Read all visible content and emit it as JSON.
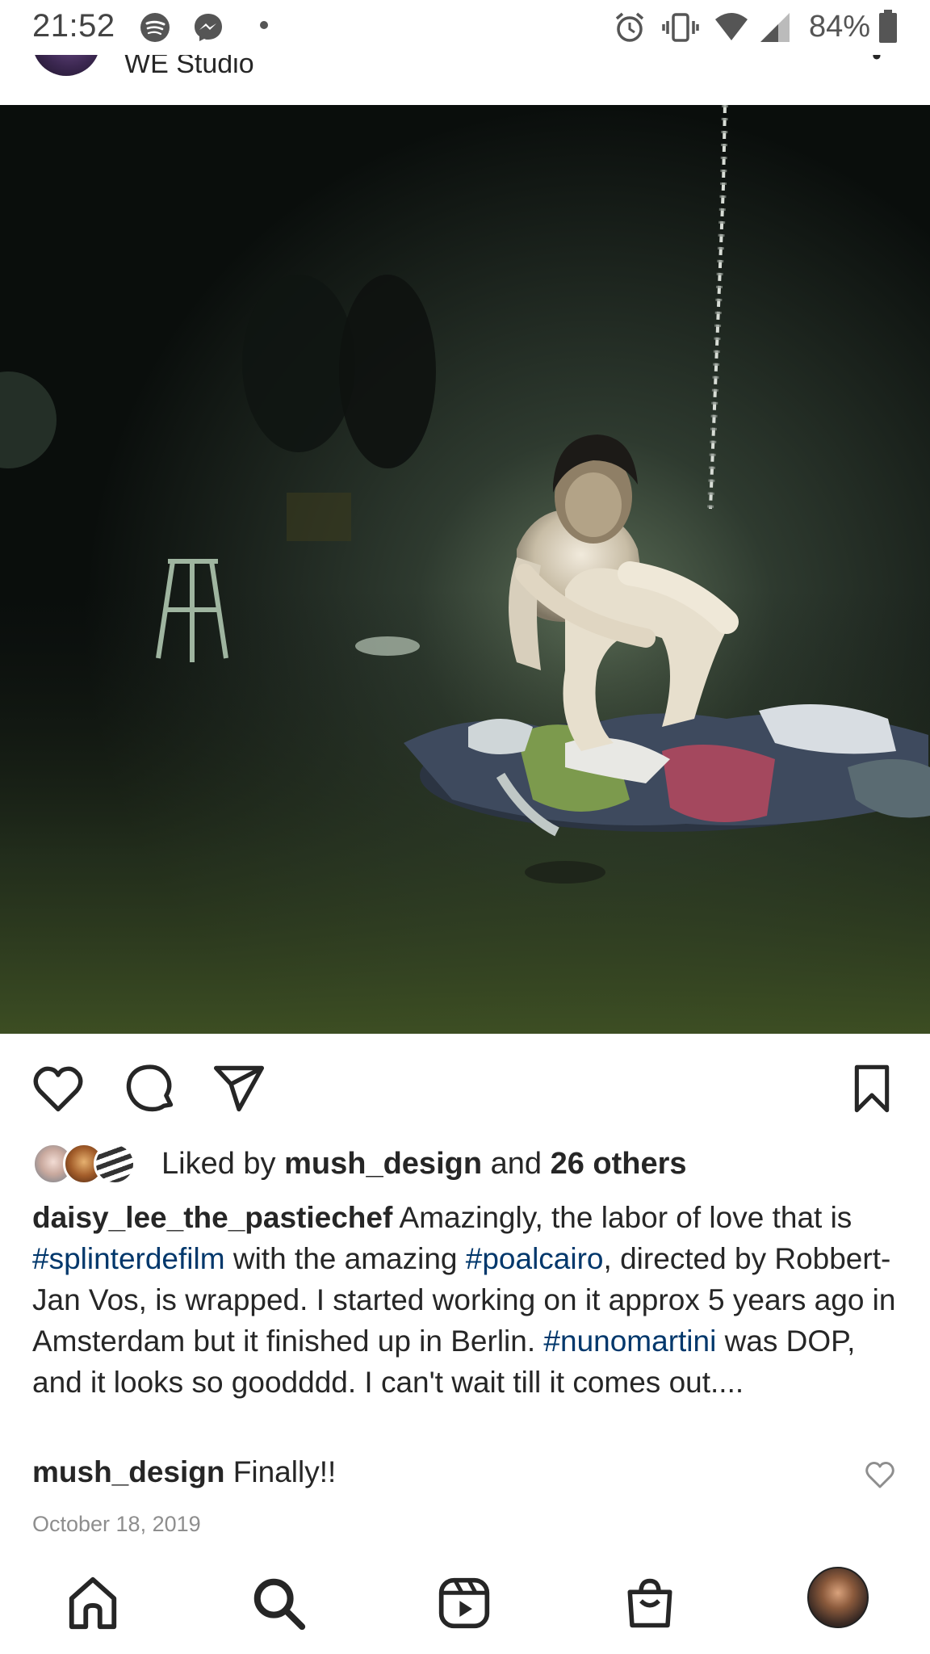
{
  "status_bar": {
    "time": "21:52",
    "battery": "84%",
    "icons": [
      "spotify-icon",
      "messenger-icon",
      "dot-icon",
      "alarm-icon",
      "vibrate-icon",
      "wifi-icon",
      "signal-icon",
      "battery-icon"
    ]
  },
  "post": {
    "author": "WE Studio",
    "image_alt": "Man sitting under a spotlight on a pile of clothes next to a hanging chain",
    "likes": {
      "prefix": "Liked by",
      "user": "mush_design",
      "joiner": "and",
      "others": "26 others"
    },
    "caption": {
      "username": "daisy_lee_the_pastiechef",
      "t1": " Amazingly, the labor of love that is ",
      "tag1": "#splinterdefilm",
      "t2": " with the amazing ",
      "tag2": "#poalcairo",
      "t3": ", directed by Robbert-Jan Vos, is wrapped. I started working on it approx 5 years ago in Amsterdam but it finished up in Berlin. ",
      "tag3": "#nunomartini",
      "t4": " was DOP, and it looks so goodddd. I can't wait till it comes out...."
    },
    "comment": {
      "username": "mush_design",
      "text": " Finally!!"
    },
    "date": "October 18, 2019"
  },
  "colors": {
    "text": "#262626",
    "hashtag": "#00376b",
    "muted": "#8e8e8e"
  },
  "nav": [
    "home-icon",
    "search-icon",
    "reels-icon",
    "shop-icon",
    "profile-avatar"
  ]
}
